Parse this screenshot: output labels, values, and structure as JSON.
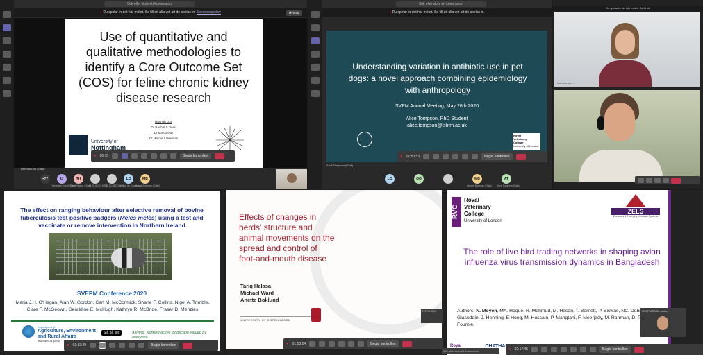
{
  "common": {
    "search_placeholder": "Sök eller skriv ett kommando",
    "banner_bold": "Du spelar in",
    "banner_text": "Du spelar in det här mötet. Se till att alla vet att de spelas in.",
    "privacy_link": "Sekretesspolicy",
    "dismiss": "Avvisa",
    "request_control": "Begär kontrollen"
  },
  "panel1": {
    "slide_title": "Use of quantitative and qualitative methodologies to identify a Core Outcome Set (COS) for feline chronic kidney disease research",
    "author": "Hannah Doit",
    "coauthors": [
      "Dr Rachel S Dean",
      "Dr Marco Duz",
      "Dr Marnie L Brennan"
    ],
    "university_line1": "University of",
    "university_line2": "Nottingham",
    "timer": "00:10",
    "presenter": "Hannah Doit (Gäst)",
    "participants": [
      {
        "initials": "+77",
        "name": "",
        "color": "#3a3a3a"
      },
      {
        "initials": "IJ",
        "name": "Westlake Ingrid (Gäst)",
        "color": "#b5a6e8"
      },
      {
        "initials": "TH",
        "name": "Tariq Halasa (Gäst)",
        "color": "#f2b8b5"
      },
      {
        "initials": "",
        "name": "+44 20 8 104 8790",
        "color": "#cfcfcf"
      },
      {
        "initials": "",
        "name": "+44 20 8829 1415",
        "color": "#cfcfcf"
      },
      {
        "initials": "LC",
        "name": "Gordon de Canal, Lu...",
        "color": "#b3d6f0"
      },
      {
        "initials": "MB",
        "name": "Marnie Brennan (Gäst)",
        "color": "#f0d08c"
      }
    ],
    "rail_label1": "Aktivitet",
    "rail_label2": "Chatt"
  },
  "panel2": {
    "slide_title": "Understanding variation in antibiotic use in pet dogs: a novel approach combining epidemiology with anthropology",
    "meeting": "SVPM Annual Meeting, May 26th 2020",
    "presenter_name": "Alice Tompson, PhD Student",
    "presenter_email": "alice.tompson@lshtm.ac.uk",
    "timer": "01:50:53",
    "presenter": "Alice Tompson (Gäst)",
    "participants": [
      {
        "initials": "LC",
        "name": "",
        "color": "#b3d6f0"
      },
      {
        "initials": "OO",
        "name": "",
        "color": "#b8e0b3"
      },
      {
        "initials": "",
        "name": "",
        "color": "#cfcfcf"
      },
      {
        "initials": "MB",
        "name": "Marnie Brennan (Gäst)",
        "color": "#f0d08c"
      },
      {
        "initials": "AT",
        "name": "Alice Tompson (Gäst)",
        "color": "#b8e0b3"
      }
    ],
    "rvc_line1": "Royal",
    "rvc_line2": "Veterinary",
    "rvc_line3": "College",
    "rvc_line4": "University of London"
  },
  "panel3": {
    "banner": "Du spelar in det här mötet. Se till att",
    "speaker": "Marloes van ..."
  },
  "panel4": {
    "title_a": "The effect on ranging behaviour after selective removal of bovine tuberculosis test positive badgers (",
    "title_italic": "Meles meles",
    "title_b": ") using a test and vaccinate or remove intervention in Northern Ireland",
    "conference": "SVEPM Conference 2020",
    "authors": "Maria J.H. O'Hagan, Alan W. Gordon, Carl M. McCormick, Shane F. Collins, Nigel A. Trimble, Clare F. McGeown, Geraldine E. McHugh, Kathryn R. McBride, Fraser D. Menzies",
    "dept_line1": "Department of",
    "dept_line2": "Agriculture, Environment",
    "dept_line3": "and Rural Affairs",
    "dept_url": "www.daera-ni.gov.uk",
    "tagline": "A living, working active landscape valued by everyone.",
    "timer": "01:33:29",
    "tooltip": "Slå på ljud"
  },
  "panel5": {
    "slide_title": "Effects of changes in herds' structure and animal movements on the spread and control of foot-and-mouth disease",
    "authors": [
      "Tariq Halasa",
      "Michael Ward",
      "Anette Boklund"
    ],
    "university": "UNIVERSITY OF COPENHAGEN",
    "timer": "01:53:24",
    "pip_label": "SVEPM 2020"
  },
  "panel6": {
    "rvc_line1": "Royal",
    "rvc_line2": "Veterinary",
    "rvc_line3": "College",
    "rvc_line4": "University of London",
    "zels": "ZELS",
    "zels_sub": "Zoonoses & Emerging Livestock Systems",
    "slide_title": "The role of live bird trading networks in shaping avian influenza virus transmission dynamics in Bangladesh",
    "authors_label": "Authors:",
    "authors_bold": "N. Moyen",
    "authors_rest": ", MA. Hoque, R. Mahmud, M. Hasan, T. Barnett, P. Biswas, NC. Debnath, M. Giasuddin, J. Henning, E Hoeg, M. Hossain, P. Mangtani, F. Meerjady, M. Rahman, D. Pfeiffer, G. Fournié.",
    "footer_a": "Royal",
    "footer_b": "CHATHAM",
    "timer": "02:17:45",
    "search": "Sök eller skriv ett kommando",
    "pip_label": "SVEPM 2020 - onlin..."
  }
}
